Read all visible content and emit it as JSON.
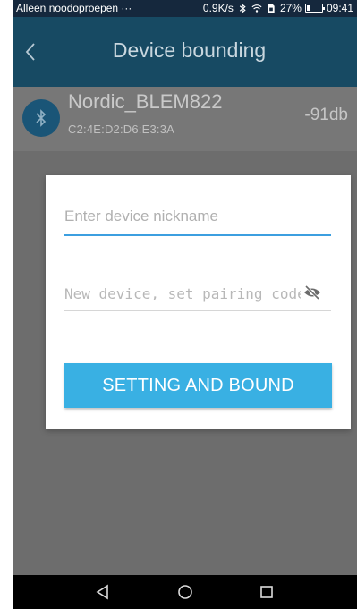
{
  "status_bar": {
    "carrier": "Alleen noodoproepen ···",
    "speed": "0.9K/s",
    "battery": "27%",
    "battery_level": 0.27,
    "time": "09:41",
    "icons": [
      "bluetooth-icon",
      "wifi-icon",
      "sim-icon",
      "battery-icon"
    ]
  },
  "app_bar": {
    "title": "Device bounding",
    "back_icon": "chevron-left-icon"
  },
  "device": {
    "name": "Nordic_BLEM822",
    "mac": "C2:4E:D2:D6:E3:3A",
    "rssi": "-91db",
    "icon": "bluetooth-icon"
  },
  "dialog": {
    "nickname_placeholder": "Enter device nickname",
    "nickname_value": "",
    "pairing_placeholder": "New device, set pairing code",
    "pairing_value": "",
    "visibility_icon": "eye-off-icon",
    "button_label": "SETTING AND BOUND"
  },
  "nav_bar": {
    "icons": [
      "back-triangle-icon",
      "home-circle-icon",
      "recents-square-icon"
    ]
  },
  "colors": {
    "status_bar": "#15283d",
    "app_bar": "#174a63",
    "accent": "#39b0e3",
    "field_focus": "#3c9fe0",
    "overlay": "#6d6d6d"
  }
}
